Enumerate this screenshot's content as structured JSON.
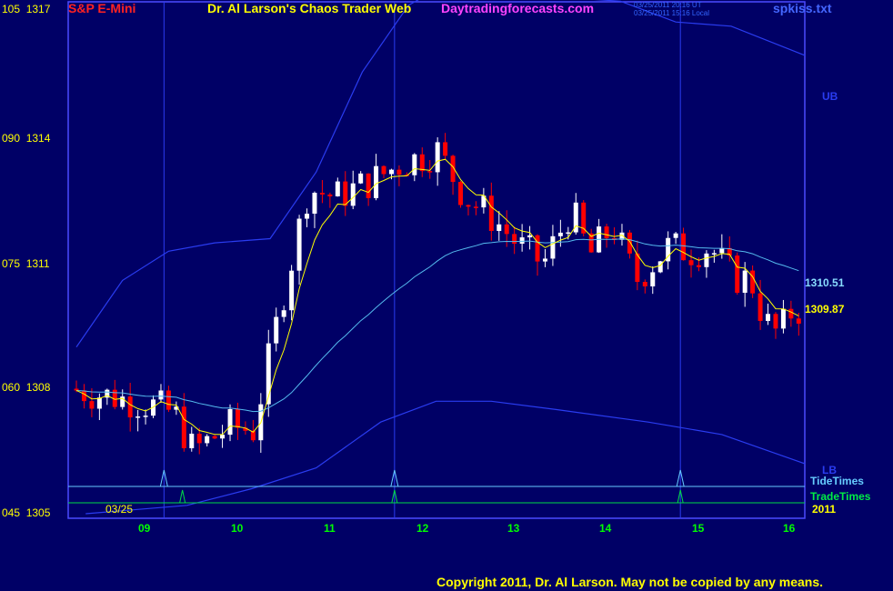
{
  "header": {
    "symbol": "S&P E-Mini",
    "title": "Dr. Al Larson's Chaos Trader Web",
    "site": "Daytradingforecasts.com",
    "ts_ut": "03/25/2011 20:16 UT",
    "ts_local": "03/25/2011 15:16 Local",
    "file": "spkiss.txt"
  },
  "footer": {
    "copyright": "Copyright 2011, Dr. Al Larson. May not be copied by any means."
  },
  "colors": {
    "background": "#000066",
    "frame": "#4a4aff",
    "up_bar": "#ffffff",
    "down_bar": "#ff0000",
    "fast_ma": "#ffff00",
    "slow_ma": "#55bbee",
    "bands": "#2a3cf0",
    "tide": "#66ccff",
    "trade": "#00dd44",
    "timelines": "#2a3cf0"
  },
  "chart_data": {
    "type": "candlestick",
    "instrument": "S&P E-Mini",
    "date": "03/25",
    "year": "2011",
    "ylim": [
      1305,
      1317.3
    ],
    "y_ticks": [
      {
        "left": "105",
        "price": "1317",
        "value": 1317
      },
      {
        "left": "090",
        "price": "1314",
        "value": 1314
      },
      {
        "left": "075",
        "price": "1311",
        "value": 1311
      },
      {
        "left": "060",
        "price": "1308",
        "value": 1308
      },
      {
        "left": "045",
        "price": "1305",
        "value": 1305
      }
    ],
    "x_ticks": [
      "09",
      "10",
      "11",
      "12",
      "13",
      "14",
      "15",
      "16"
    ],
    "x_hours": [
      9.0,
      10.0,
      11.0,
      12.0,
      13.0,
      14.0,
      15.0,
      16.0
    ],
    "xlim": [
      8.3,
      16.2
    ],
    "time_markers": [
      9.25,
      11.75,
      14.85
    ],
    "tide_times": [
      9.25,
      11.75,
      14.85
    ],
    "trade_times": [
      9.45,
      11.75,
      14.85
    ],
    "labels": {
      "ub": "UB",
      "lb": "LB",
      "tide": "TideTimes",
      "trade": "TradeTimes"
    },
    "last_values": {
      "slow_ma": "1310.51",
      "fast_ma": "1309.87"
    },
    "anchors": [
      [
        8.3,
        1308.0
      ],
      [
        8.8,
        1307.8
      ],
      [
        9.2,
        1307.6
      ],
      [
        9.45,
        1307.4
      ],
      [
        9.65,
        1306.5
      ],
      [
        9.85,
        1306.8
      ],
      [
        10.05,
        1307.1
      ],
      [
        10.3,
        1307.0
      ],
      [
        10.6,
        1310.0
      ],
      [
        10.9,
        1312.8
      ],
      [
        11.2,
        1312.6
      ],
      [
        11.6,
        1313.0
      ],
      [
        11.9,
        1313.4
      ],
      [
        12.3,
        1313.7
      ],
      [
        12.6,
        1312.6
      ],
      [
        12.9,
        1312.1
      ],
      [
        13.2,
        1311.4
      ],
      [
        13.45,
        1311.0
      ],
      [
        13.75,
        1312.3
      ],
      [
        13.95,
        1311.2
      ],
      [
        14.2,
        1311.9
      ],
      [
        14.45,
        1310.6
      ],
      [
        14.8,
        1311.4
      ],
      [
        15.05,
        1311.3
      ],
      [
        15.25,
        1311.4
      ],
      [
        15.5,
        1310.7
      ],
      [
        15.7,
        1310.6
      ],
      [
        15.85,
        1309.6
      ],
      [
        16.0,
        1309.3
      ],
      [
        16.15,
        1309.9
      ]
    ],
    "upper_band": [
      [
        8.3,
        1309.0
      ],
      [
        8.8,
        1310.6
      ],
      [
        9.3,
        1311.3
      ],
      [
        9.8,
        1311.5
      ],
      [
        10.4,
        1311.6
      ],
      [
        10.9,
        1313.2
      ],
      [
        11.4,
        1315.6
      ],
      [
        11.9,
        1317.2
      ],
      [
        12.3,
        1317.7
      ],
      [
        13.0,
        1317.7
      ],
      [
        13.5,
        1317.4
      ],
      [
        14.2,
        1317.3
      ],
      [
        14.8,
        1316.8
      ],
      [
        15.4,
        1316.7
      ],
      [
        16.2,
        1316.0
      ]
    ],
    "lower_band": [
      [
        8.4,
        1305.0
      ],
      [
        9.5,
        1305.2
      ],
      [
        10.2,
        1305.6
      ],
      [
        10.9,
        1306.1
      ],
      [
        11.6,
        1307.2
      ],
      [
        12.2,
        1307.7
      ],
      [
        12.8,
        1307.7
      ],
      [
        13.5,
        1307.5
      ],
      [
        14.5,
        1307.2
      ],
      [
        15.3,
        1306.9
      ],
      [
        16.2,
        1306.2
      ]
    ]
  }
}
